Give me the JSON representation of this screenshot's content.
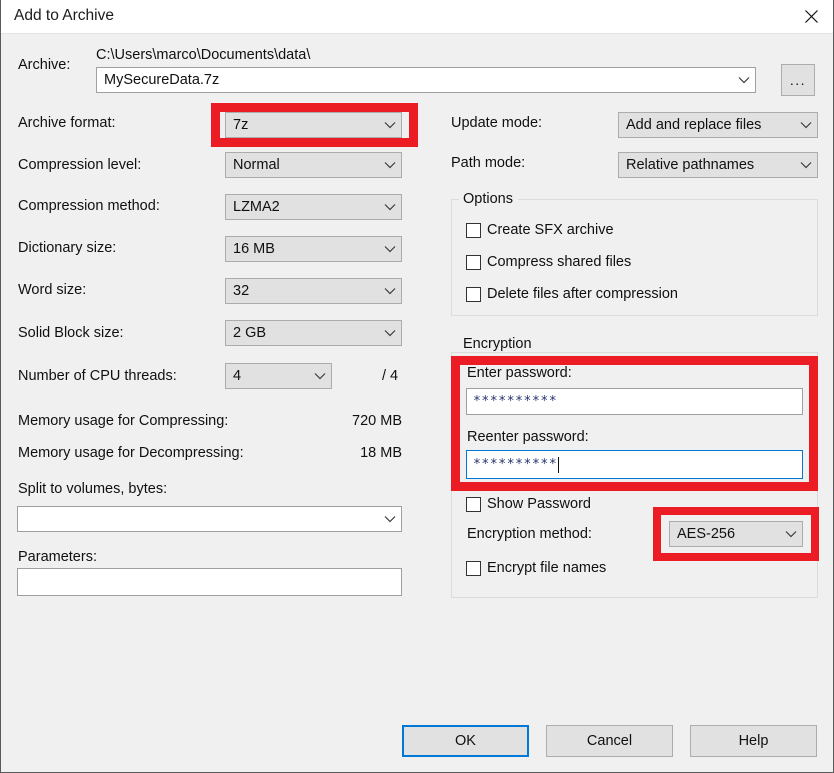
{
  "window": {
    "title": "Add to Archive",
    "close_icon": "close-icon"
  },
  "archive": {
    "label": "Archive:",
    "path": "C:\\Users\\marco\\Documents\\data\\",
    "name": "MySecureData.7z",
    "browse_label": "...",
    "format_label": "Archive format:",
    "format_value": "7z"
  },
  "left_column": {
    "compression_level_label": "Compression level:",
    "compression_level_value": "Normal",
    "compression_method_label": "Compression method:",
    "compression_method_value": "LZMA2",
    "dictionary_size_label": "Dictionary size:",
    "dictionary_size_value": "16 MB",
    "word_size_label": "Word size:",
    "word_size_value": "32",
    "solid_block_size_label": "Solid Block size:",
    "solid_block_size_value": "2 GB",
    "cpu_threads_label": "Number of CPU threads:",
    "cpu_threads_value": "4",
    "cpu_threads_total": "/ 4",
    "mem_compress_label": "Memory usage for Compressing:",
    "mem_compress_value": "720 MB",
    "mem_decompress_label": "Memory usage for Decompressing:",
    "mem_decompress_value": "18 MB",
    "split_label": "Split to volumes, bytes:",
    "split_value": "",
    "parameters_label": "Parameters:",
    "parameters_value": ""
  },
  "right_column": {
    "update_mode_label": "Update mode:",
    "update_mode_value": "Add and replace files",
    "path_mode_label": "Path mode:",
    "path_mode_value": "Relative pathnames",
    "options_caption": "Options",
    "options": [
      {
        "label": "Create SFX archive",
        "checked": false
      },
      {
        "label": "Compress shared files",
        "checked": false
      },
      {
        "label": "Delete files after compression",
        "checked": false
      }
    ],
    "encryption_caption": "Encryption",
    "enter_password_label": "Enter password:",
    "enter_password_value": "**********",
    "reenter_password_label": "Reenter password:",
    "reenter_password_value": "**********",
    "show_password_label": "Show Password",
    "show_password_checked": false,
    "encryption_method_label": "Encryption method:",
    "encryption_method_value": "AES-256",
    "encrypt_file_names_label": "Encrypt file names",
    "encrypt_file_names_checked": false
  },
  "buttons": {
    "ok": "OK",
    "cancel": "Cancel",
    "help": "Help"
  },
  "highlight": {
    "color": "#ec1c24",
    "targets": [
      "archive-format-combo",
      "password-fields",
      "encryption-method-combo"
    ]
  }
}
